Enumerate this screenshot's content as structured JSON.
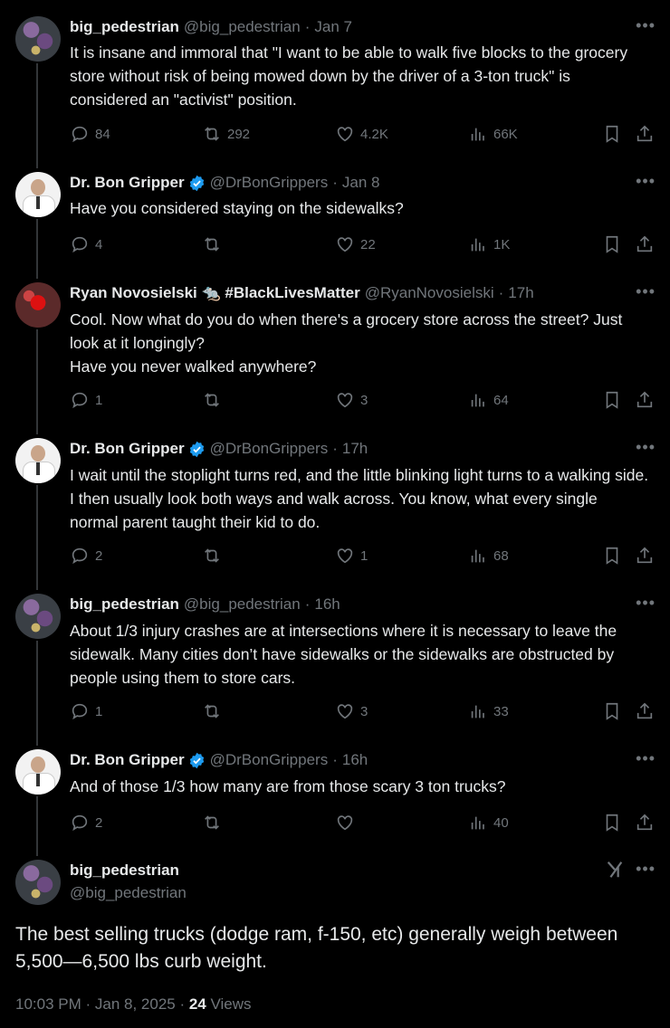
{
  "tweets": [
    {
      "name": "big_pedestrian",
      "handle": "@big_pedestrian",
      "time": "Jan 7",
      "text": "It is insane and immoral that \"I want to be able to walk five blocks to the grocery store without risk of being mowed down by the driver of a 3-ton truck\" is considered an \"activist\" position.",
      "replies": "84",
      "retweets": "292",
      "likes": "4.2K",
      "views": "66K"
    },
    {
      "name": "Dr. Bon Gripper",
      "handle": "@DrBonGrippers",
      "time": "Jan 8",
      "text": "Have you considered staying on the sidewalks?",
      "replies": "4",
      "retweets": "",
      "likes": "22",
      "views": "1K"
    },
    {
      "name": "Ryan Novosielski 🐀 #BlackLivesMatter",
      "handle": "@RyanNovosielski",
      "time": "17h",
      "text": "Cool. Now what do you do when there's a grocery store across the street? Just look at it longingly?\nHave you never walked anywhere?",
      "replies": "1",
      "retweets": "",
      "likes": "3",
      "views": "64"
    },
    {
      "name": "Dr. Bon Gripper",
      "handle": "@DrBonGrippers",
      "time": "17h",
      "text": "I wait until the stoplight turns red, and the little blinking light turns to a walking side. I then usually look both ways and walk across. You know, what every single normal parent taught their kid to do.",
      "replies": "2",
      "retweets": "",
      "likes": "1",
      "views": "68"
    },
    {
      "name": "big_pedestrian",
      "handle": "@big_pedestrian",
      "time": "16h",
      "text": "About 1/3 injury crashes are at intersections where it is necessary to leave the sidewalk. Many cities don’t have sidewalks or the sidewalks are obstructed by people using them to store cars.",
      "replies": "1",
      "retweets": "",
      "likes": "3",
      "views": "33"
    },
    {
      "name": "Dr. Bon Gripper",
      "handle": "@DrBonGrippers",
      "time": "16h",
      "text": "And of those 1/3 how many are from those scary 3 ton trucks?",
      "replies": "2",
      "retweets": "",
      "likes": "",
      "views": "40"
    }
  ],
  "main": {
    "name": "big_pedestrian",
    "handle": "@big_pedestrian",
    "text": "The best selling trucks (dodge ram, f-150, etc) generally weigh between 5,500—6,500 lbs curb weight.",
    "datetime": "10:03 PM · Jan 8, 2025 · ",
    "views_count": "24",
    "views_label": " Views",
    "grok_label": "X/"
  },
  "icons": {
    "more": "more-icon",
    "reply": "reply-icon",
    "retweet": "retweet-icon",
    "like": "like-icon",
    "views": "views-icon",
    "bookmark": "bookmark-icon",
    "share": "share-icon",
    "verified": "verified-badge-icon",
    "grok": "grok-icon"
  },
  "colors": {
    "background": "#000000",
    "text": "#e7e9ea",
    "muted": "#71767b",
    "verified": "#1d9bf0"
  }
}
